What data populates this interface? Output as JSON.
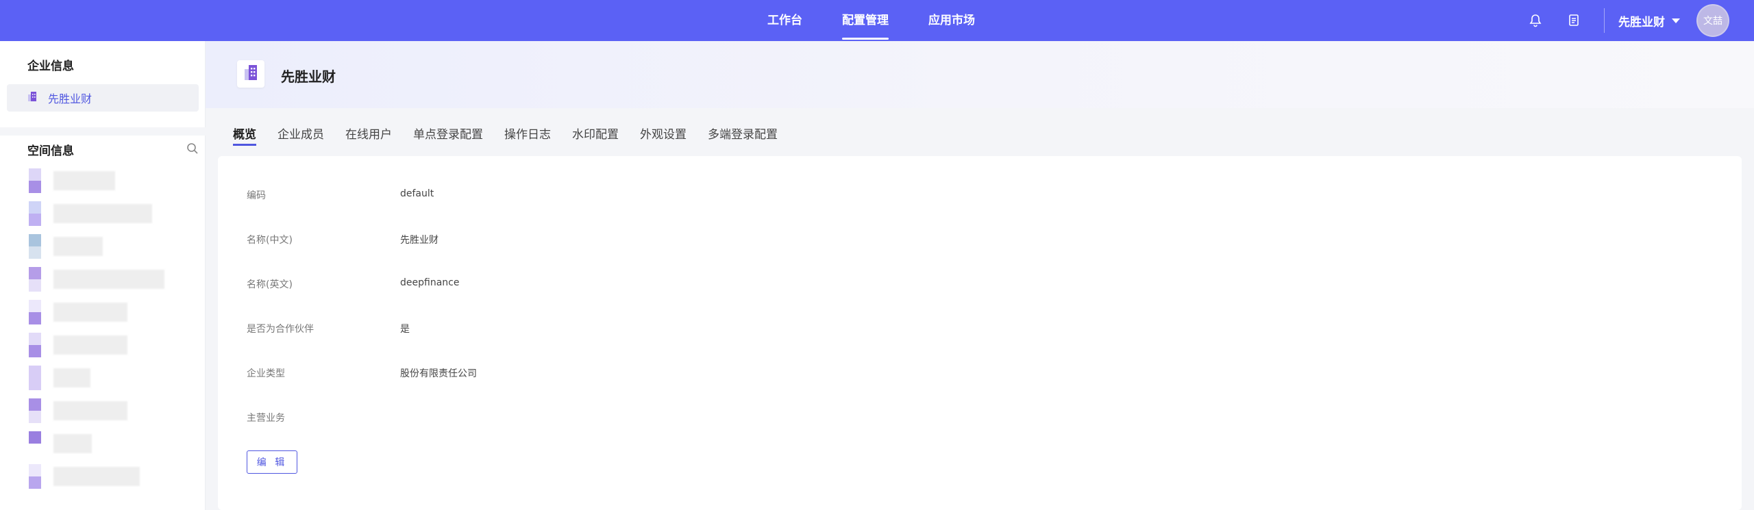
{
  "topnav": {
    "items": [
      {
        "label": "工作台"
      },
      {
        "label": "配置管理"
      },
      {
        "label": "应用市场"
      }
    ],
    "org_name": "先胜业财",
    "avatar_text": "文喆"
  },
  "sidebar": {
    "enterprise_title": "企业信息",
    "enterprise_item": "先胜业财",
    "space_title": "空间信息"
  },
  "hero": {
    "title": "先胜业财"
  },
  "tabs": [
    {
      "label": "概览"
    },
    {
      "label": "企业成员"
    },
    {
      "label": "在线用户"
    },
    {
      "label": "单点登录配置"
    },
    {
      "label": "操作日志"
    },
    {
      "label": "水印配置"
    },
    {
      "label": "外观设置"
    },
    {
      "label": "多端登录配置"
    }
  ],
  "fields": [
    {
      "label": "编码",
      "value": "default"
    },
    {
      "label": "名称(中文)",
      "value": "先胜业财"
    },
    {
      "label": "名称(英文)",
      "value": "deepfinance"
    },
    {
      "label": "是否为合作伙伴",
      "value": "是"
    },
    {
      "label": "企业类型",
      "value": "股份有限责任公司"
    },
    {
      "label": "主营业务",
      "value": ""
    }
  ],
  "edit_button": "编 辑",
  "colors": {
    "brand": "#5b61f5",
    "accent": "#4f56e0"
  }
}
